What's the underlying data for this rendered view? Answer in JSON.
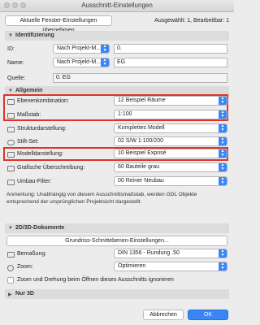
{
  "window": {
    "title": "Ausschnitt-Einstellungen"
  },
  "toolbar": {
    "apply_label": "Aktuelle Fenster-Einstellungen übernehmen",
    "status": "Ausgewählt: 1, Bearbeitbar: 1"
  },
  "identifizierung": {
    "title": "Identifizierung",
    "id_label": "ID:",
    "id_select": "Nach Projekt-M...",
    "id_value": "0.",
    "name_label": "Name:",
    "name_select": "Nach Projekt-M...",
    "name_value": "EG",
    "quelle_label": "Quelle:",
    "quelle_value": "0. EG"
  },
  "allgemein": {
    "title": "Allgemein",
    "rows": [
      {
        "label": "Ebenenkombination:",
        "value": "12 Beispiel Räume",
        "icon": "layers-icon"
      },
      {
        "label": "Maßstab:",
        "value": "1:100",
        "icon": "scale-icon"
      },
      {
        "label": "Strukturdarstellung:",
        "value": "Komplettes Modell",
        "icon": "structure-icon"
      },
      {
        "label": "Stift-Set:",
        "value": "02 S/W 1:100/200",
        "icon": "pen-icon"
      },
      {
        "label": "Modelldarstellung:",
        "value": "10 Beispiel Exposé",
        "icon": "model-view-icon"
      },
      {
        "label": "Grafische Überschreibung:",
        "value": "60 Bauteile grau",
        "icon": "graphic-override-icon"
      },
      {
        "label": "Umbau-Filter:",
        "value": "00 Reiner Neubau",
        "icon": "renovation-filter-icon"
      }
    ],
    "note": "Anmerkung: Unabhängig von diesem Ausschnittsmaßstab, werden GDL Objekte entsprechend der ursprünglichen Projektsicht dargestellt."
  },
  "dokumente": {
    "title": "2D/3D-Dokumente",
    "grundriss_button": "Grundriss-Schnittebenen-Einstellungen...",
    "bemassung_label": "Bemaßung:",
    "bemassung_value": "DIN 1356 - Rundung .50",
    "zoom_label": "Zoom:",
    "zoom_value": "Optimieren",
    "ignore_label": "Zoom und Drehung beim Öffnen dieses Ausschnitts ignorieren"
  },
  "nur3d": {
    "title": "Nur 3D"
  },
  "footer": {
    "cancel_label": "Abbrechen",
    "ok_label": "OK"
  },
  "colors": {
    "accent": "#3b86f7",
    "highlight": "#e0322a"
  }
}
